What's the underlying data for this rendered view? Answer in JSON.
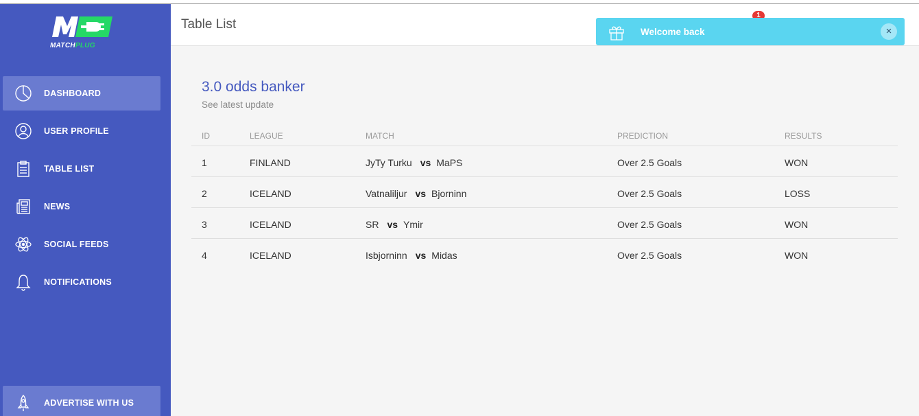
{
  "brand": {
    "logo_mark": "M",
    "word_white": "MATCH",
    "word_green": "PLUG",
    "colors": {
      "primary": "#4559bf",
      "accent": "#25d866"
    }
  },
  "sidebar": {
    "items": [
      {
        "label": "DASHBOARD",
        "icon": "pie-chart-icon",
        "active": true
      },
      {
        "label": "USER PROFILE",
        "icon": "user-icon",
        "active": false
      },
      {
        "label": "TABLE LIST",
        "icon": "clipboard-icon",
        "active": false
      },
      {
        "label": "NEWS",
        "icon": "newspaper-icon",
        "active": false
      },
      {
        "label": "SOCIAL FEEDS",
        "icon": "atom-icon",
        "active": false
      },
      {
        "label": "NOTIFICATIONS",
        "icon": "bell-icon",
        "active": false
      }
    ],
    "footer_item": {
      "label": "ADVERTISE WITH US",
      "icon": "rocket-icon"
    }
  },
  "header": {
    "title": "Table List",
    "notification_count": "1"
  },
  "toast": {
    "message": "Welcome back",
    "close": "×",
    "icon": "gift-icon",
    "color": "#5ad5f0"
  },
  "card": {
    "title": "3.0 odds banker",
    "subtitle": "See latest update"
  },
  "table": {
    "columns": [
      "ID",
      "LEAGUE",
      "MATCH",
      "PREDICTION",
      "RESULTS"
    ],
    "rows": [
      {
        "id": "1",
        "league": "FINLAND",
        "home": "JyTy Turku",
        "vs": "vs",
        "away": "MaPS",
        "prediction": "Over 2.5 Goals",
        "result": "WON"
      },
      {
        "id": "2",
        "league": "ICELAND",
        "home": "Vatnaliljur",
        "vs": "vs",
        "away": "Bjorninn",
        "prediction": "Over 2.5 Goals",
        "result": "LOSS"
      },
      {
        "id": "3",
        "league": "ICELAND",
        "home": "SR",
        "vs": "vs",
        "away": "Ymir",
        "prediction": "Over 2.5 Goals",
        "result": "WON"
      },
      {
        "id": "4",
        "league": "ICELAND",
        "home": "Isbjorninn",
        "vs": "vs",
        "away": "Midas",
        "prediction": "Over 2.5 Goals",
        "result": "WON"
      }
    ]
  }
}
